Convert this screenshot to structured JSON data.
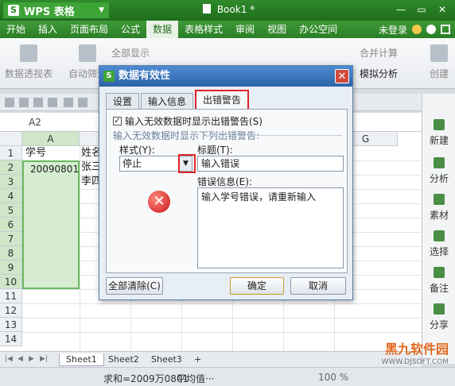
{
  "app": {
    "name": "WPS 表格",
    "doc_title": "Book1 *"
  },
  "menu": {
    "items": [
      "开始",
      "插入",
      "页面布局",
      "公式",
      "数据",
      "表格样式",
      "审阅",
      "视图",
      "办公空间"
    ],
    "active": "数据",
    "login": "未登录"
  },
  "ribbon": {
    "pivot": "数据透视表",
    "autofilter": "自动筛选",
    "show_all": "全部显示",
    "merge_calc": "合并计算",
    "simulate": "模拟分析",
    "create": "创建"
  },
  "namebox": "A2",
  "grid": {
    "columns": [
      "A",
      "B",
      "C",
      "D",
      "E",
      "F",
      "G"
    ],
    "rows": [
      "1",
      "2",
      "3",
      "4",
      "5",
      "6",
      "7",
      "8",
      "9",
      "10",
      "11",
      "12",
      "13",
      "14"
    ],
    "a1": "学号",
    "a2": "20090801",
    "b1": "姓名",
    "b2": "张三",
    "b3": "李四"
  },
  "right_panel": {
    "items": [
      "新建",
      "分析",
      "素材",
      "选择",
      "备注",
      "分享"
    ]
  },
  "sheets": {
    "tabs": [
      "Sheet1",
      "Sheet2",
      "Sheet3"
    ],
    "active": "Sheet1",
    "add": "+"
  },
  "status": {
    "sum": "求和=2009万0801",
    "avg": "平均值···",
    "zoom": "100 %"
  },
  "watermark": {
    "brand": "黑九软件园",
    "url": "WWW.DJSOFT.COM"
  },
  "dialog": {
    "title": "数据有效性",
    "close": "✕",
    "tabs": [
      "设置",
      "输入信息",
      "出错警告"
    ],
    "active_tab": "出错警告",
    "checkbox_label": "输入无效数据时显示出错警告(S)",
    "checkbox_checked": true,
    "section_label": "输入无效数据时显示下列出错警告:",
    "style_label": "样式(Y):",
    "style_value": "停止",
    "title_label": "标题(T):",
    "title_value": "输入错误",
    "message_label": "错误信息(E):",
    "message_value": "输入学号错误，请重新输入",
    "clear_all": "全部清除(C)",
    "ok": "确定",
    "cancel": "取消"
  }
}
